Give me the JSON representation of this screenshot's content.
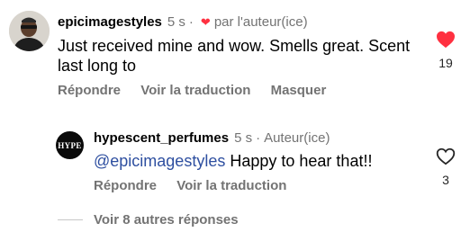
{
  "comment": {
    "username": "epicimagestyles",
    "time": "5 s",
    "liked_by_author_label": "par l'auteur(ice)",
    "text": "Just received mine and wow. Smells great. Scent last long to",
    "like_count": "19",
    "actions": {
      "reply": "Répondre",
      "translate": "Voir la traduction",
      "hide": "Masquer"
    }
  },
  "reply": {
    "avatar_logo": "HYPE",
    "username": "hypescent_perfumes",
    "time": "5 s",
    "author_badge": "Auteur(ice)",
    "mention": "@epicimagestyles",
    "text": "Happy to hear that!!",
    "like_count": "3",
    "actions": {
      "reply": "Répondre",
      "translate": "Voir la traduction"
    }
  },
  "more_replies_label": "Voir 8 autres réponses",
  "colors": {
    "heart_red": "#ff3040",
    "mention_blue": "#2e4fa0",
    "meta_gray": "#737373"
  }
}
